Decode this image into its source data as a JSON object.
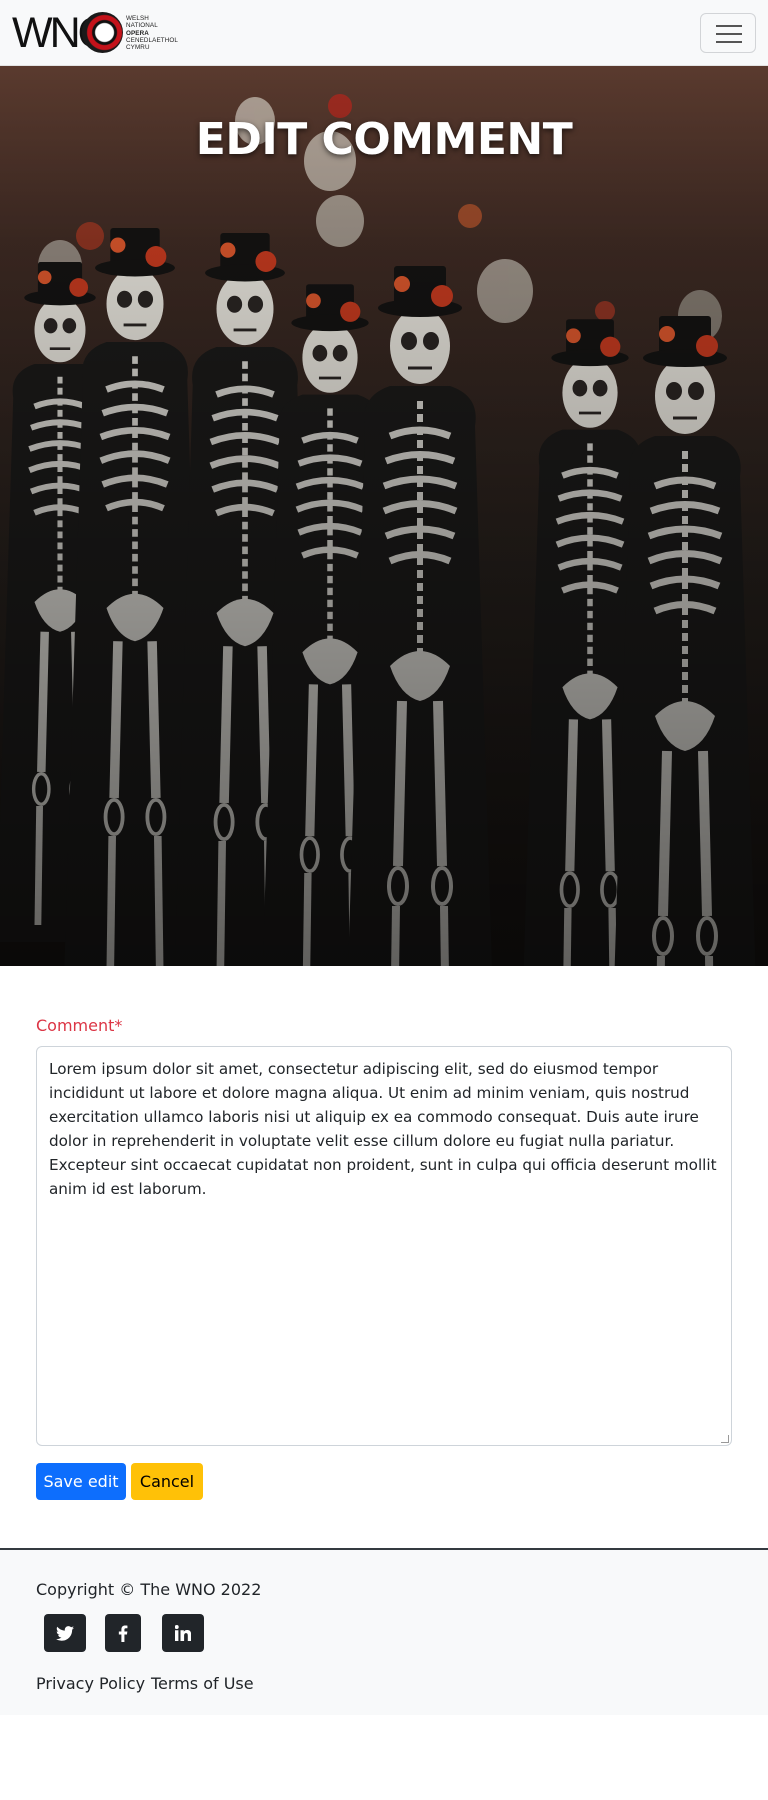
{
  "brand": {
    "letters": "WNO",
    "tagline": [
      "WELSH",
      "NATIONAL",
      "OPERA",
      "CENEDLAETHOL",
      "CYMRU"
    ]
  },
  "nav": {
    "toggler_icon": "hamburger-menu-icon"
  },
  "hero": {
    "title": "EDIT COMMENT"
  },
  "form": {
    "comment_label": "Comment*",
    "comment_value": "Lorem ipsum dolor sit amet, consectetur adipiscing elit, sed do eiusmod tempor incididunt ut labore et dolore magna aliqua. Ut enim ad minim veniam, quis nostrud exercitation ullamco laboris nisi ut aliquip ex ea commodo consequat. Duis aute irure dolor in reprehenderit in voluptate velit esse cillum dolore eu fugiat nulla pariatur. Excepteur sint occaecat cupidatat non proident, sunt in culpa qui officia deserunt mollit anim id est laborum.",
    "save_label": "Save edit",
    "cancel_label": "Cancel"
  },
  "footer": {
    "copyright": "Copyright © The WNO 2022",
    "social": [
      {
        "icon": "twitter-icon"
      },
      {
        "icon": "facebook-icon"
      },
      {
        "icon": "linkedin-icon"
      }
    ],
    "links": [
      "Privacy Policy",
      "Terms of Use"
    ]
  },
  "colors": {
    "primary": "#0d6efd",
    "warning": "#ffc107",
    "required_label": "#dc3545",
    "dark": "#212529",
    "light_bg": "#f8f9fa"
  }
}
